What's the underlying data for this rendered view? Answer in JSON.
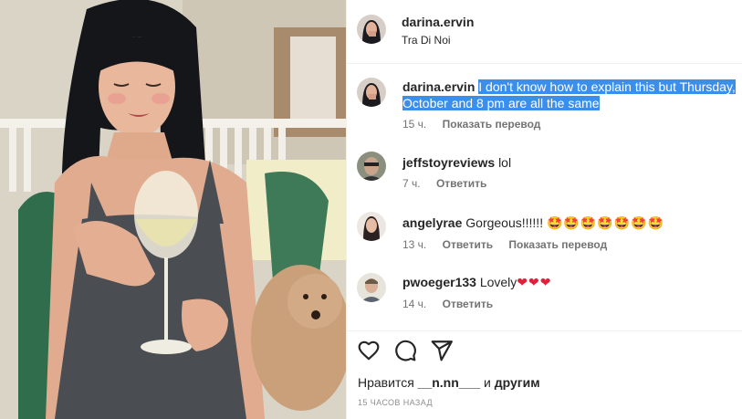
{
  "post": {
    "username": "darina.ervin",
    "location": "Tra Di Noi"
  },
  "caption": {
    "username": "darina.ervin",
    "text": "I don't know how to explain this but Thursday, October and 8 pm are all the same",
    "time": "15 ч.",
    "translate": "Показать перевод"
  },
  "comments": [
    {
      "username": "jeffstoyreviews",
      "text": "lol",
      "time": "7 ч.",
      "reply": "Ответить",
      "translate": ""
    },
    {
      "username": "angelyrae",
      "text": "Gorgeous!!!!!!",
      "emoji": "🤩🤩🤩🤩🤩🤩🤩",
      "time": "13 ч.",
      "reply": "Ответить",
      "translate": "Показать перевод"
    },
    {
      "username": "pwoeger133",
      "text": "Lovely",
      "emoji": "❤❤❤",
      "time": "14 ч.",
      "reply": "Ответить",
      "translate": ""
    }
  ],
  "likes": {
    "prefix": "Нравится",
    "user": "__n.nn___",
    "mid": "и",
    "suffix": "другим"
  },
  "time_ago": "15 ЧАСОВ НАЗАД",
  "icons": {
    "like": "heart-icon",
    "comment": "comment-icon",
    "share": "paper-plane-icon"
  },
  "colors": {
    "selection": "#3b8eea",
    "heart": "#e0203a",
    "muted": "#737373"
  }
}
